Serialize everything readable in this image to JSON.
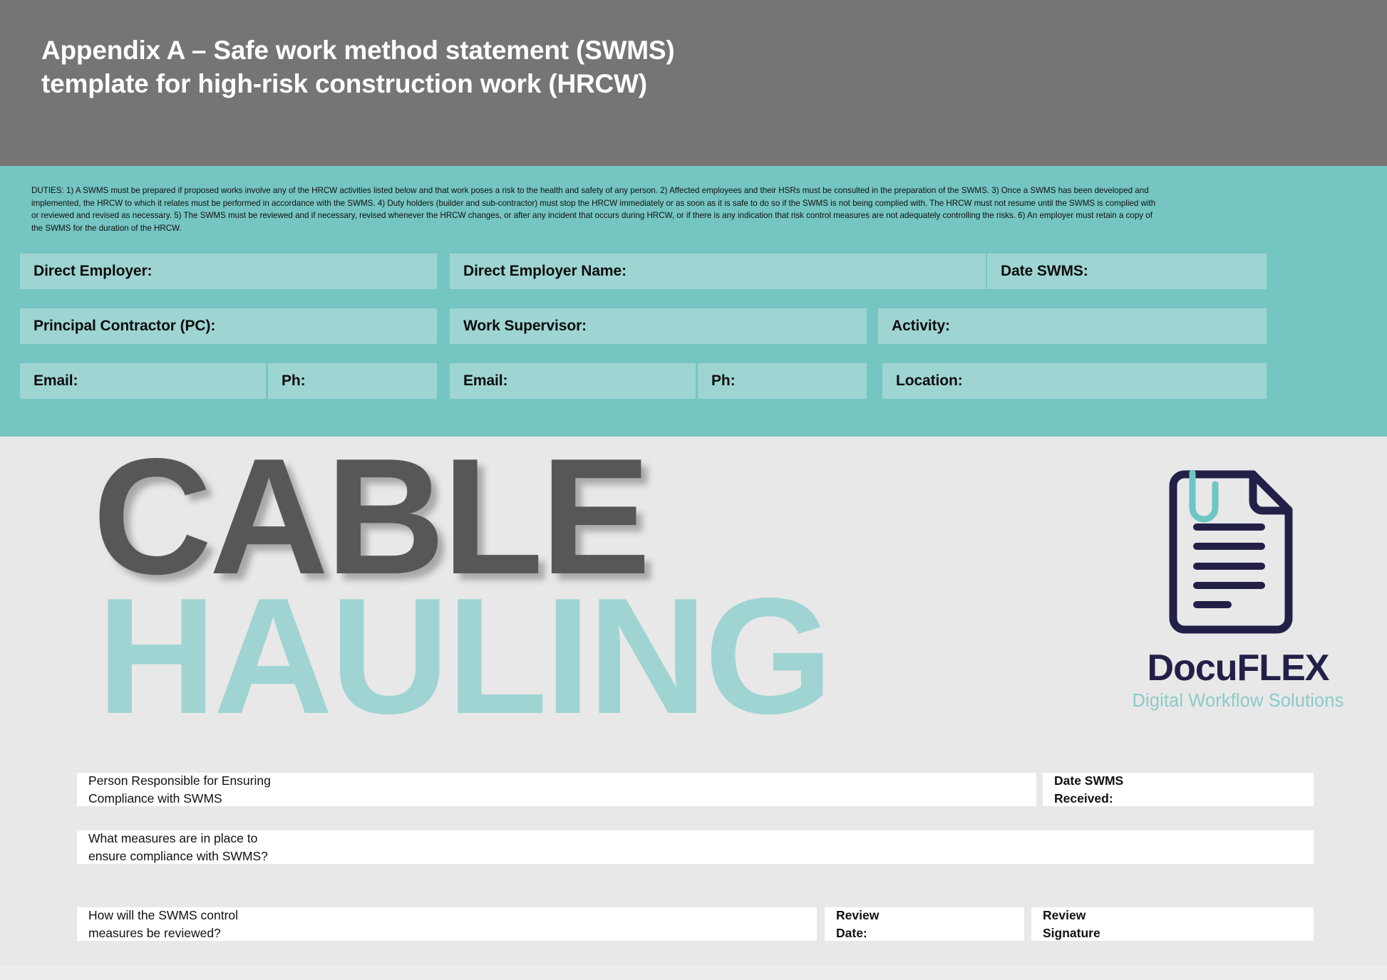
{
  "header": {
    "title_line1": "Appendix A – Safe work method statement (SWMS)",
    "title_line2": "template for high-risk construction work (HRCW)"
  },
  "duties": {
    "text": "DUTIES: 1) A SWMS must be prepared if proposed works involve any of the HRCW activities listed below and that work poses a risk to the health and safety of any person. 2) Affected employees and their HSRs must be consulted in the preparation of the SWMS. 3) Once a SWMS has been developed and implemented, the HRCW to which it relates must be performed in accordance with the SWMS. 4) Duty holders (builder and sub-contractor) must stop the HRCW immediately or as soon as it is safe to do so if the SWMS is not being complied with. The HRCW must not resume until the SWMS is complied with or reviewed and revised as necessary. 5) The SWMS must be reviewed and if necessary, revised whenever the HRCW changes, or after any incident that occurs during HRCW, or if there is any indication that risk control measures are not adequately controlling the risks. 6) An employer must retain a copy of the SWMS for the duration of the HRCW."
  },
  "form_fields": {
    "direct_employer": "Direct Employer:",
    "direct_employer_name": "Direct Employer Name:",
    "date_swms": "Date SWMS:",
    "principal_contractor": "Principal Contractor (PC):",
    "work_supervisor": "Work Supervisor:",
    "activity": "Activity:",
    "email_1": "Email:",
    "ph_1": "Ph:",
    "email_2": "Email:",
    "ph_2": "Ph:",
    "location": "Location:"
  },
  "hero": {
    "word_top": "CABLE",
    "word_bottom": "HAULING"
  },
  "logo": {
    "name": "DocuFLEX",
    "tagline": "Digital Workflow Solutions",
    "icon": "document-paperclip-icon"
  },
  "bottom_form": {
    "person_responsible": "Person Responsible for Ensuring\nCompliance with SWMS",
    "date_swms_received": "Date SWMS\nReceived:",
    "measures_in_place": "What measures are in place to\nensure compliance with SWMS?",
    "how_reviewed": "How will the SWMS control\nmeasures be reviewed?",
    "review_date": "Review\nDate:",
    "review_signature": "Review\nSignature"
  },
  "colors": {
    "header_grey": "#757575",
    "teal_band": "#75c5c3",
    "field_teal": "#9ed5d3",
    "page_grey": "#e8e8e8",
    "hero_grey": "#575757",
    "hero_teal": "#9fd4d2",
    "logo_navy": "#232048",
    "logo_teal": "#8ccac8"
  }
}
